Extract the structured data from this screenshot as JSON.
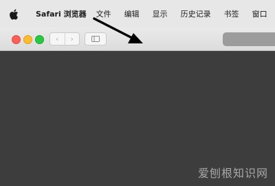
{
  "menubar": {
    "apple_icon": "apple-logo-icon",
    "items": [
      {
        "label": "Safari 浏览器",
        "bold": true
      },
      {
        "label": "文件"
      },
      {
        "label": "编辑"
      },
      {
        "label": "显示"
      },
      {
        "label": "历史记录"
      },
      {
        "label": "书签"
      },
      {
        "label": "窗口"
      }
    ]
  },
  "toolbar": {
    "window_controls": [
      "close",
      "minimize",
      "zoom"
    ],
    "back_icon": "chevron-left-icon",
    "back_glyph": "‹",
    "forward_icon": "chevron-right-icon",
    "forward_glyph": "›",
    "sidebar_icon": "sidebar-icon"
  },
  "annotation": {
    "arrow_color": "#000000"
  },
  "watermark": {
    "text": "爱刨根知识网"
  },
  "colors": {
    "desktop": "#3d3d3d",
    "menubar": "#e7e7e7",
    "close": "#fc5f57",
    "minimize": "#fdbc2e",
    "zoom": "#28c840"
  }
}
